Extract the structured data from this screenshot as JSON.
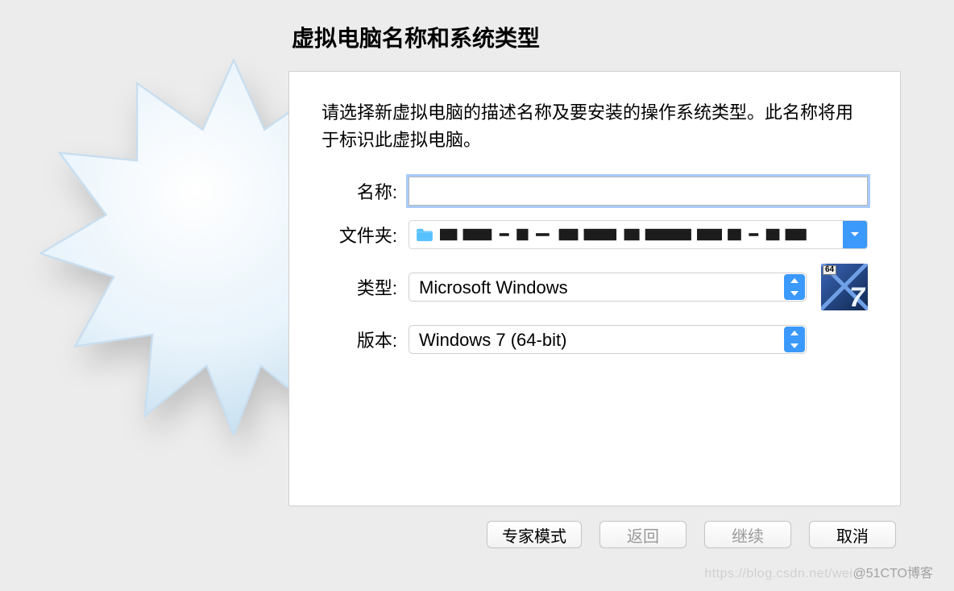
{
  "header": {
    "title": "虚拟电脑名称和系统类型"
  },
  "description": "请选择新虚拟电脑的描述名称及要安装的操作系统类型。此名称将用于标识此虚拟电脑。",
  "labels": {
    "name": "名称:",
    "folder": "文件夹:",
    "type": "类型:",
    "version": "版本:"
  },
  "fields": {
    "name_value": "",
    "type_value": "Microsoft Windows",
    "version_value": "Windows 7 (64-bit)"
  },
  "os_badge": {
    "bits": "64",
    "version_glyph": "7"
  },
  "buttons": {
    "expert": "专家模式",
    "back": "返回",
    "continue": "继续",
    "cancel": "取消"
  },
  "watermark": {
    "faint": "https://blog.csdn.net/wei",
    "text": "@51CTO博客"
  }
}
